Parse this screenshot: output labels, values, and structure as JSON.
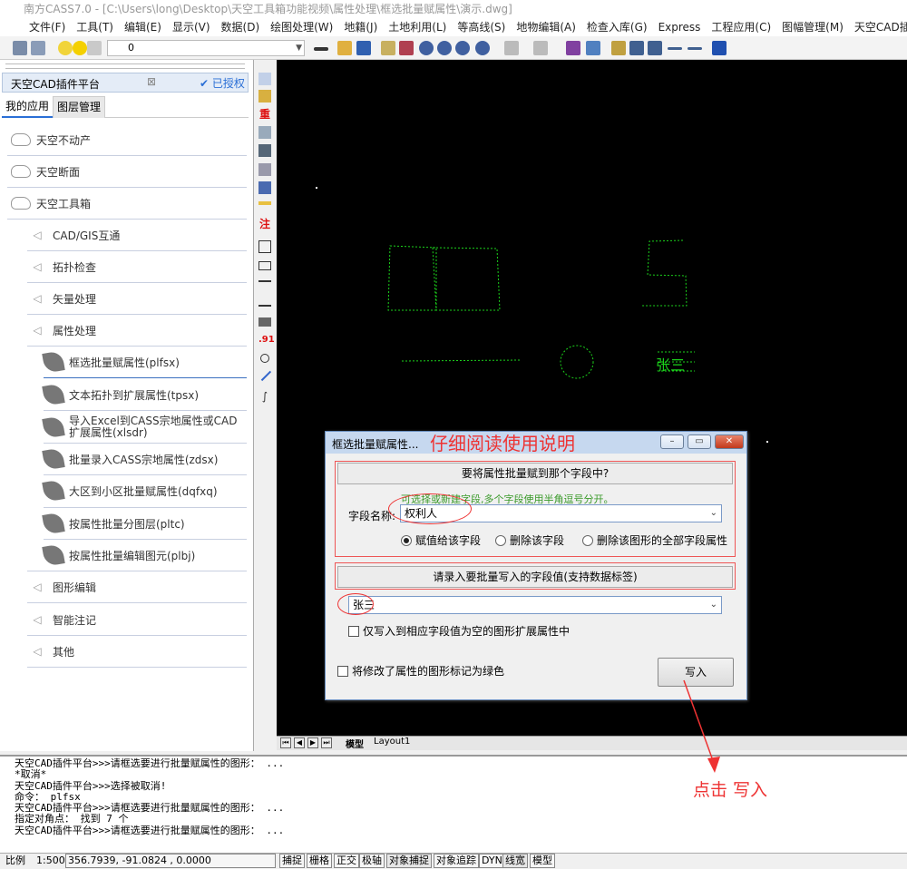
{
  "app": {
    "title": "南方CASS7.0 - [C:\\Users\\long\\Desktop\\天空工具箱功能视频\\属性处理\\框选批量赋属性\\演示.dwg]"
  },
  "menu": [
    "文件(F)",
    "工具(T)",
    "编辑(E)",
    "显示(V)",
    "数据(D)",
    "绘图处理(W)",
    "地籍(J)",
    "土地利用(L)",
    "等高线(S)",
    "地物编辑(A)",
    "检查入库(G)",
    "Express",
    "工程应用(C)",
    "图幅管理(M)",
    "天空CAD插件平台"
  ],
  "toolbar": {
    "layer_value": "0"
  },
  "panel": {
    "title": "天空CAD插件平台",
    "close": "⊠",
    "auth": "已授权",
    "tabs": [
      "我的应用",
      "图层管理"
    ],
    "top_items": [
      "天空不动产",
      "天空断面",
      "天空工具箱"
    ],
    "sub_items": [
      "CAD/GIS互通",
      "拓扑检查",
      "矢量处理",
      "属性处理"
    ],
    "attr_items": [
      "框选批量赋属性(plfsx)",
      "文本拓扑到扩展属性(tpsx)",
      "导入Excel到CASS宗地属性或CAD扩展属性(xlsdr)",
      "批量录入CASS宗地属性(zdsx)",
      "大区到小区批量赋属性(dqfxq)",
      "按属性批量分图层(pltc)",
      "按属性批量编辑图元(plbj)"
    ],
    "bottom_items": [
      "图形编辑",
      "智能注记",
      "其他"
    ]
  },
  "vtools": {
    "zhong": "重",
    "zhu": "注",
    "num": ".91"
  },
  "layout_tabs": [
    "模型",
    "Layout1"
  ],
  "command_lines": [
    "天空CAD插件平台>>>请框选要进行批量赋属性的图形： ...",
    "*取消*",
    "天空CAD插件平台>>>选择被取消!",
    "命令： plfsx",
    "天空CAD插件平台>>>请框选要进行批量赋属性的图形： ...",
    "指定对角点： 找到 7 个",
    "天空CAD插件平台>>>请框选要进行批量赋属性的图形： ..."
  ],
  "status": {
    "scale_label": "比例",
    "scale": "1:500",
    "coords": "356.7939,  -91.0824 ,  0.0000",
    "toggles": [
      "捕捉",
      "栅格",
      "正交",
      "极轴",
      "对象捕捉",
      "对象追踪",
      "DYN",
      "线宽",
      "模型"
    ]
  },
  "dialog": {
    "title": "框选批量赋属性...",
    "note": "仔细阅读使用说明",
    "section1": "要将属性批量赋到那个字段中?",
    "hint": "可选择或新建字段,多个字段使用半角逗号分开。",
    "field_label": "字段名称:",
    "field_value": "权利人",
    "radios": [
      "赋值给该字段",
      "删除该字段",
      "删除该图形的全部字段属性"
    ],
    "section2": "请录入要批量写入的字段值(支持数据标签)",
    "value": "张三",
    "only_empty": "仅写入到相应字段值为空的图形扩展属性中",
    "mark_green": "将修改了属性的图形标记为绿色",
    "write_button": "写入",
    "min": "–",
    "max": "▭",
    "close": "✕"
  },
  "annotation": "点击  写入",
  "canvas_text": "张三"
}
